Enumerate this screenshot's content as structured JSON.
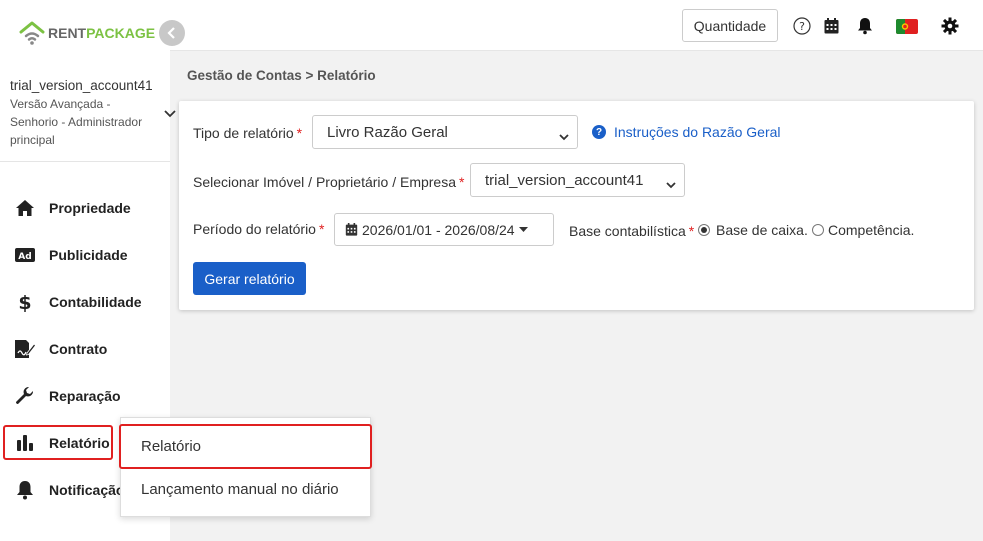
{
  "brand": {
    "name_part1": "RENT",
    "name_part2": "PACKAGE",
    "color_green": "#7cc243"
  },
  "account": {
    "name": "trial_version_account41",
    "role_line1": "Versão Avançada -",
    "role_line2": "Senhorio - Administrador",
    "role_line3": "principal"
  },
  "sidebar": {
    "items": [
      {
        "label": "Propriedade",
        "icon": "home-icon"
      },
      {
        "label": "Publicidade",
        "icon": "ad-icon"
      },
      {
        "label": "Contabilidade",
        "icon": "dollar-icon"
      },
      {
        "label": "Contrato",
        "icon": "contract-icon"
      },
      {
        "label": "Reparação",
        "icon": "wrench-icon"
      },
      {
        "label": "Relatório",
        "icon": "bar-chart-icon"
      },
      {
        "label": "Notificação",
        "icon": "bell-icon"
      }
    ],
    "selected": "Relatório"
  },
  "topbar": {
    "quantity_label": "Quantidade",
    "icons": [
      "help-circle-icon",
      "calendar-icon",
      "bell-icon",
      "portugal-flag-icon",
      "gear-icon"
    ]
  },
  "breadcrumb": "Gestão de Contas > Relatório",
  "form": {
    "report_type_label": "Tipo de relatório",
    "report_type_value": "Livro Razão Geral",
    "help_link": "Instruções do Razão Geral",
    "select_entity_label": "Selecionar Imóvel / Proprietário / Empresa",
    "select_entity_value": "trial_version_account41",
    "period_label": "Período do relatório",
    "period_value": "2026/01/01 - 2026/08/24",
    "accounting_basis_label": "Base contabilística",
    "basis_options": [
      "Base de caixa.",
      "Competência."
    ],
    "basis_selected": "Base de caixa.",
    "required_mark": "*",
    "generate_button": "Gerar relatório"
  },
  "submenu": {
    "items": [
      "Relatório",
      "Lançamento manual no diário"
    ],
    "selected": "Relatório"
  },
  "colors": {
    "accent_blue": "#1a5fc8",
    "highlight_red": "#e02020"
  }
}
